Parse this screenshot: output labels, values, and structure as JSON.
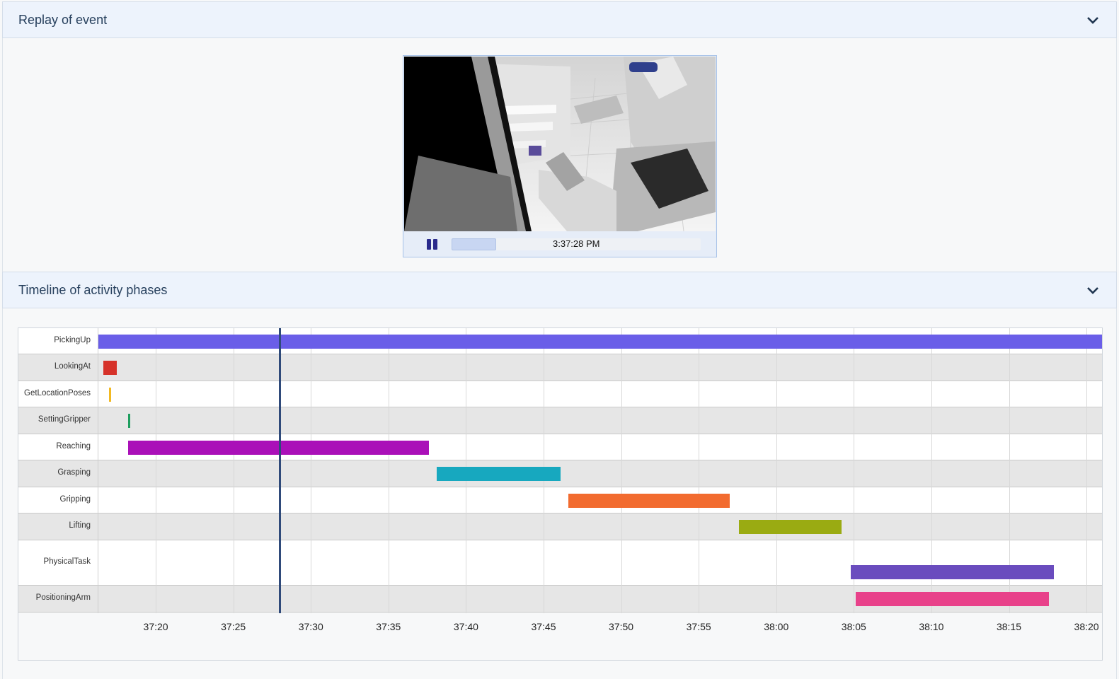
{
  "panels": {
    "replay": {
      "title": "Replay of event"
    },
    "timeline": {
      "title": "Timeline of activity phases"
    }
  },
  "player": {
    "time": "3:37:28 PM",
    "progress": 0.18,
    "state": "playing"
  },
  "chart_data": {
    "type": "timeline",
    "rows": [
      "PickingUp",
      "LookingAt",
      "GetLocationPoses",
      "SettingGripper",
      "Reaching",
      "Grasping",
      "Gripping",
      "Lifting",
      "PhysicalTask",
      "PositioningArm"
    ],
    "ticks": [
      "37:20",
      "37:25",
      "37:30",
      "37:35",
      "37:40",
      "37:45",
      "37:50",
      "37:55",
      "38:00",
      "38:05",
      "38:10",
      "38:15",
      "38:20"
    ],
    "xlim": [
      "37:16.3",
      "38:21.0"
    ],
    "cursor": "37:28.0",
    "bars": [
      {
        "row": "PickingUp",
        "start": "37:16.3",
        "end": "38:21.0",
        "color": "#6a5ee8"
      },
      {
        "row": "LookingAt",
        "start": "37:16.6",
        "end": "37:17.5",
        "color": "#d6322a"
      },
      {
        "row": "GetLocationPoses",
        "start": "37:17.0",
        "end": "37:17.2",
        "color": "#f2b922"
      },
      {
        "row": "SettingGripper",
        "start": "37:18.2",
        "end": "37:18.4",
        "color": "#1e9e5e"
      },
      {
        "row": "Reaching",
        "start": "37:18.2",
        "end": "37:37.6",
        "color": "#aa10b8"
      },
      {
        "row": "Grasping",
        "start": "37:38.1",
        "end": "37:46.1",
        "color": "#17a8bf"
      },
      {
        "row": "Gripping",
        "start": "37:46.6",
        "end": "37:57.0",
        "color": "#f26b2f"
      },
      {
        "row": "Lifting",
        "start": "37:57.6",
        "end": "38:04.2",
        "color": "#9aab12"
      },
      {
        "row": "PhysicalTask",
        "start": "38:04.8",
        "end": "38:17.9",
        "color": "#6a4cbe"
      },
      {
        "row": "PositioningArm",
        "start": "38:05.1",
        "end": "38:17.6",
        "color": "#e8418a"
      }
    ]
  },
  "icons": {
    "collapse": "chevron-down-icon",
    "pause": "pause-icon"
  }
}
